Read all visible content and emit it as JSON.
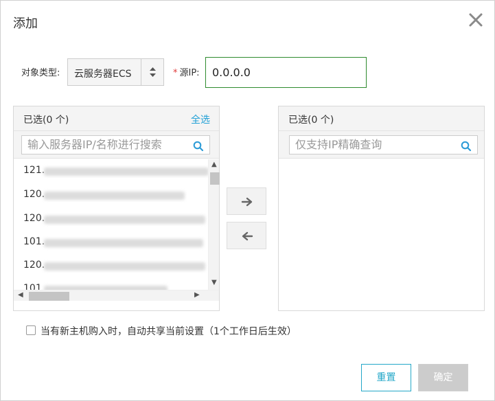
{
  "dialog": {
    "title": "添加",
    "close_icon": "close-icon"
  },
  "form": {
    "object_type_label": "对象类型:",
    "object_type_value": "云服务器ECS",
    "source_ip_label": "源IP:",
    "source_ip_value": "0.0.0.0"
  },
  "left_panel": {
    "header": "已选(0 个)",
    "select_all": "全选",
    "search_placeholder": "输入服务器IP/名称进行搜索",
    "items": [
      "121.",
      "120.",
      "120.",
      "101.",
      "120.",
      "101."
    ]
  },
  "right_panel": {
    "header": "已选(0 个)",
    "search_placeholder": "仅支持IP精确查询"
  },
  "transfer": {
    "move_right_icon": "arrow-right-icon",
    "move_left_icon": "arrow-left-icon"
  },
  "auto_share": {
    "checked": false,
    "label": "当有新主机购入时，自动共享当前设置（1个工作日后生效）"
  },
  "buttons": {
    "reset": "重置",
    "confirm": "确定"
  },
  "colors": {
    "accent": "#23a7c8",
    "input_focus_border": "#2d8a2d",
    "required": "#e03a3a",
    "disabled_button": "#cccccc"
  }
}
